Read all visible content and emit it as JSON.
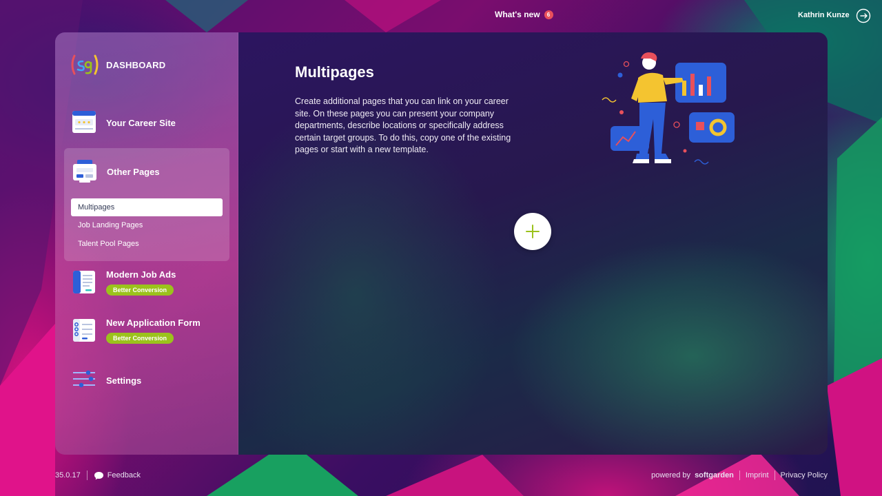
{
  "topbar": {
    "whats_new_label": "What's new",
    "whats_new_count": "6",
    "user_name": "Kathrin Kunze"
  },
  "sidebar": {
    "brand": "DASHBOARD",
    "items": [
      {
        "label": "Your Career Site",
        "icon": "career-site-icon"
      },
      {
        "label": "Other Pages",
        "icon": "other-pages-icon",
        "subitems": [
          "Multipages",
          "Job Landing Pages",
          "Talent Pool Pages"
        ],
        "active_subitem": "Multipages"
      },
      {
        "label": "Modern Job Ads",
        "icon": "job-ads-icon",
        "badge": "Better Conversion"
      },
      {
        "label": "New Application Form",
        "icon": "application-form-icon",
        "badge": "Better Conversion"
      },
      {
        "label": "Settings",
        "icon": "settings-sliders-icon"
      }
    ]
  },
  "main": {
    "title": "Multipages",
    "description": "Create additional pages that you can link on your career site. On these pages you can present your company departments, describe locations or specifically address certain target groups. To do this, copy one of the existing pages or start with a new template."
  },
  "footer": {
    "version": "35.0.17",
    "feedback": "Feedback",
    "powered_prefix": "powered by",
    "powered_brand": "softgarden",
    "imprint": "Imprint",
    "privacy": "Privacy Policy"
  },
  "colors": {
    "accent_green": "#9bc21c",
    "badge_red": "#e8505b"
  }
}
